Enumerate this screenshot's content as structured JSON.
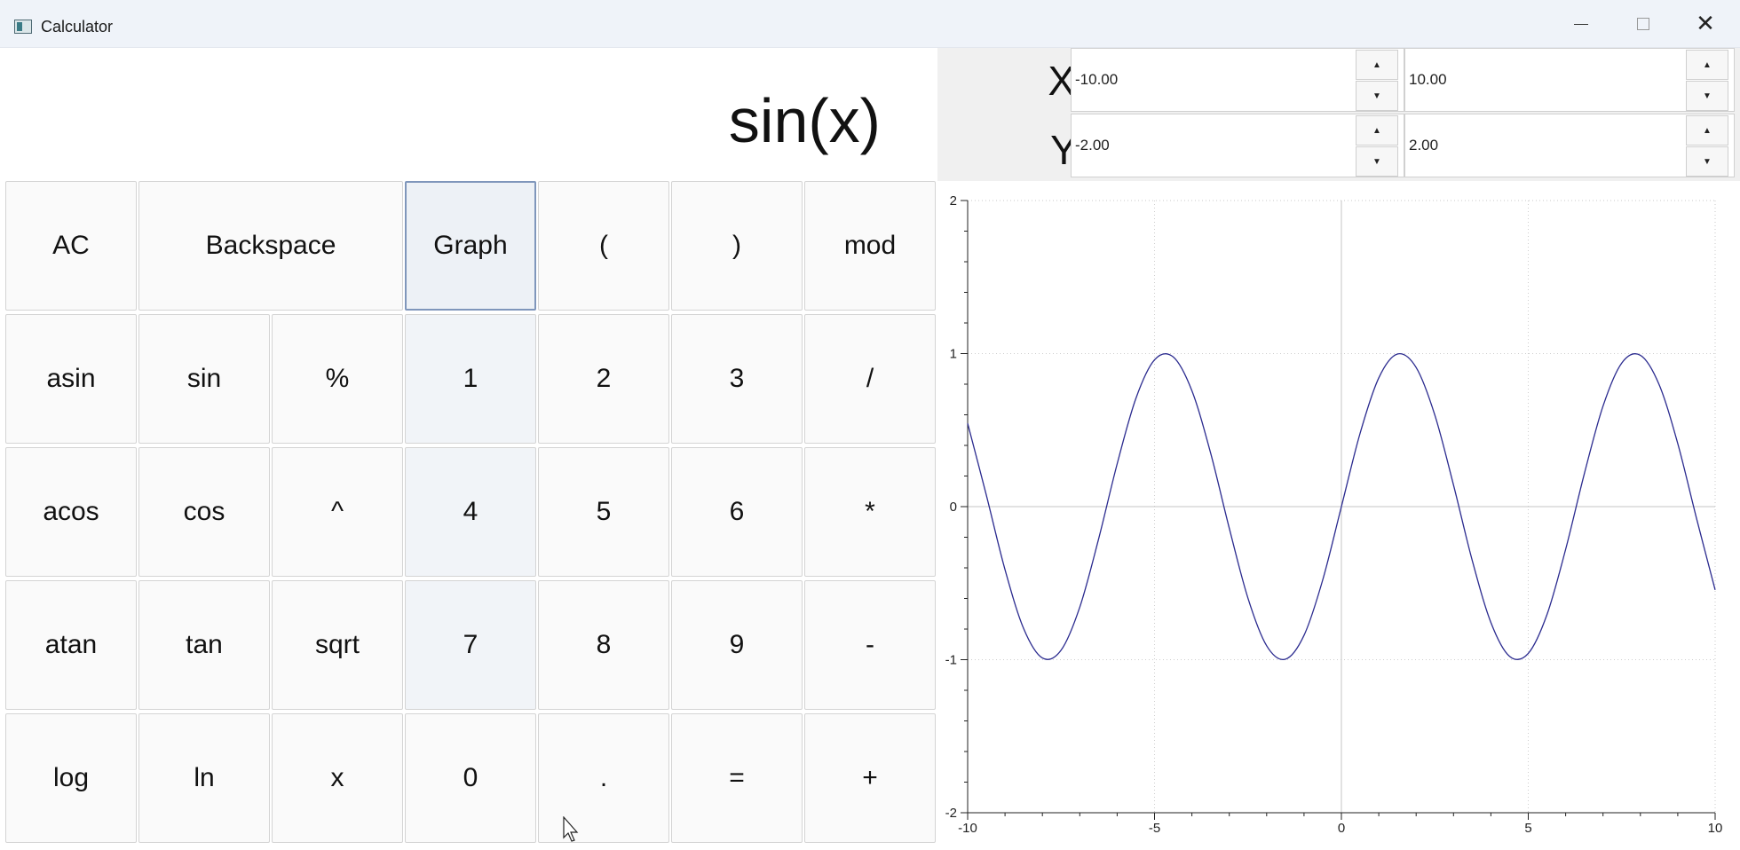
{
  "window": {
    "title": "Calculator",
    "controls": {
      "minimize": "–",
      "maximize": "□",
      "close": "✕"
    }
  },
  "display": {
    "expression": "sin(x)"
  },
  "ranges": {
    "x_label": "X:",
    "y_label": "Y:",
    "x_min": "-10.00",
    "x_max": "10.00",
    "y_min": "-2.00",
    "y_max": "2.00",
    "spin_up": "▲",
    "spin_down": "▼"
  },
  "keys": {
    "ac": "AC",
    "backspace": "Backspace",
    "graph": "Graph",
    "lparen": "(",
    "rparen": ")",
    "mod": "mod",
    "asin": "asin",
    "sin": "sin",
    "percent": "%",
    "one": "1",
    "two": "2",
    "three": "3",
    "divide": "/",
    "acos": "acos",
    "cos": "cos",
    "power": "^",
    "four": "4",
    "five": "5",
    "six": "6",
    "multiply": "*",
    "atan": "atan",
    "tan": "tan",
    "sqrt": "sqrt",
    "seven": "7",
    "eight": "8",
    "nine": "9",
    "minus": "-",
    "log": "log",
    "ln": "ln",
    "x": "x",
    "zero": "0",
    "dot": ".",
    "equals": "=",
    "plus": "+"
  },
  "chart_data": {
    "type": "line",
    "title": "",
    "xlabel": "",
    "ylabel": "",
    "function": "sin(x)",
    "xlim": [
      -10,
      10
    ],
    "ylim": [
      -2,
      2
    ],
    "xticks": [
      "-10",
      "-5",
      "0",
      "5",
      "10"
    ],
    "yticks": [
      "2",
      "1",
      "0",
      "-1",
      "-2"
    ],
    "grid": true,
    "line_color": "#2b2b8f",
    "series": [
      {
        "x": [
          -10,
          -9.5,
          -9,
          -8.5,
          -8,
          -7.5,
          -7,
          -6.5,
          -6,
          -5.5,
          -5,
          -4.5,
          -4,
          -3.5,
          -3,
          -2.5,
          -2,
          -1.5,
          -1,
          -0.5,
          0,
          0.5,
          1,
          1.5,
          2,
          2.5,
          3,
          3.5,
          4,
          4.5,
          5,
          5.5,
          6,
          6.5,
          7,
          7.5,
          8,
          8.5,
          9,
          9.5,
          10
        ],
        "y": [
          0.544,
          0.075,
          -0.412,
          -0.798,
          -0.989,
          -0.938,
          -0.657,
          -0.215,
          0.279,
          0.706,
          0.959,
          0.978,
          0.757,
          0.351,
          -0.141,
          -0.598,
          -0.909,
          -0.997,
          -0.841,
          -0.479,
          0,
          0.479,
          0.841,
          0.997,
          0.909,
          0.598,
          0.141,
          -0.351,
          -0.757,
          -0.978,
          -0.959,
          -0.706,
          -0.279,
          0.215,
          0.657,
          0.938,
          0.989,
          0.798,
          0.412,
          -0.075,
          -0.544
        ]
      }
    ]
  }
}
